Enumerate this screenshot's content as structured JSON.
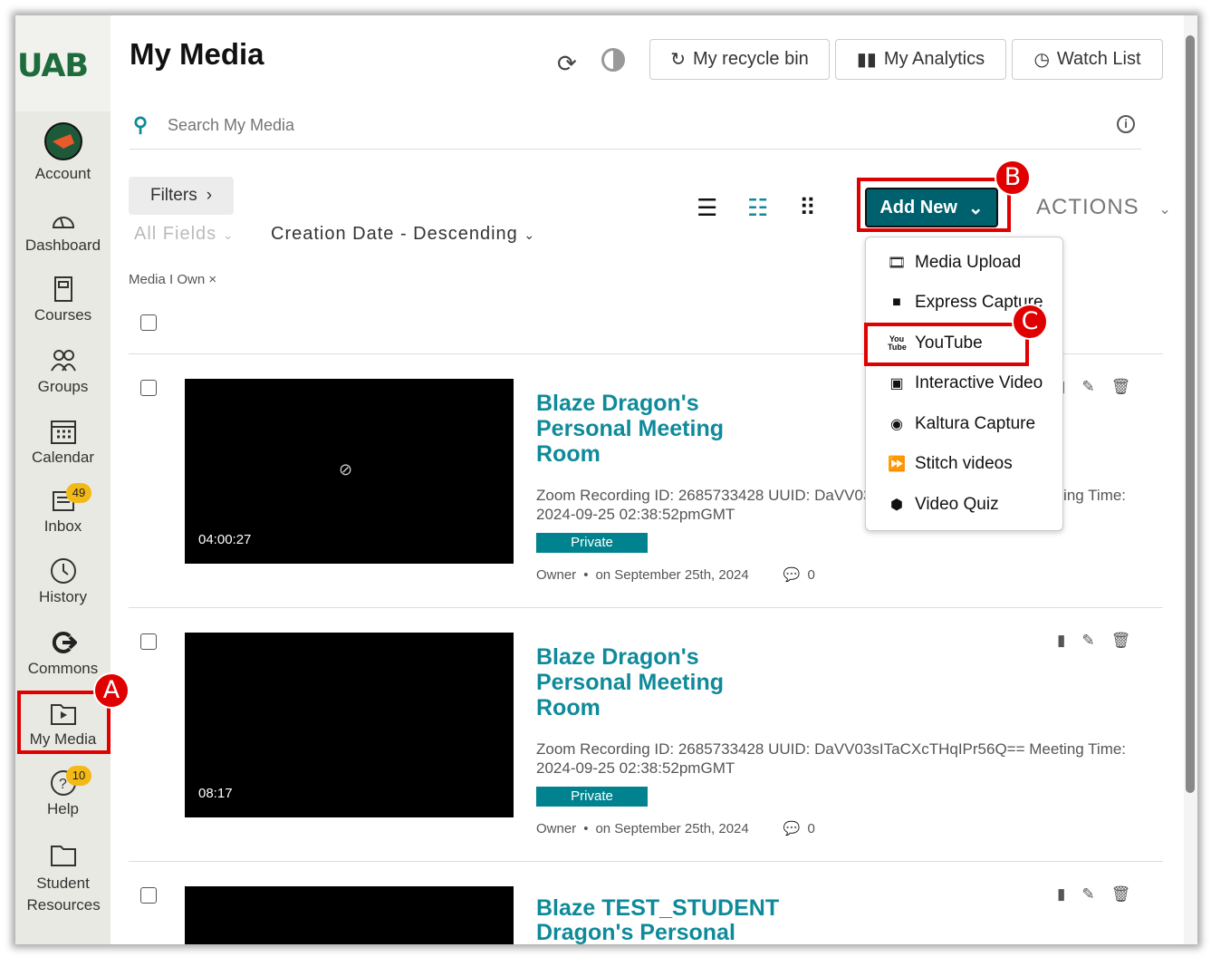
{
  "sidebar": {
    "logo": "UAB",
    "items": [
      {
        "label": "Account",
        "icon": "dragon-avatar-icon"
      },
      {
        "label": "Dashboard",
        "icon": "dashboard-icon"
      },
      {
        "label": "Courses",
        "icon": "book-icon"
      },
      {
        "label": "Groups",
        "icon": "groups-icon"
      },
      {
        "label": "Calendar",
        "icon": "calendar-icon"
      },
      {
        "label": "Inbox",
        "icon": "inbox-icon",
        "badge": "49"
      },
      {
        "label": "History",
        "icon": "clock-icon"
      },
      {
        "label": "Commons",
        "icon": "commons-icon"
      },
      {
        "label": "My Media",
        "icon": "media-folder-icon"
      },
      {
        "label": "Help",
        "icon": "help-icon",
        "badge": "10"
      },
      {
        "label": "Student Resources",
        "icon": "folder-icon"
      }
    ]
  },
  "header": {
    "title": "My Media",
    "recycle": "My recycle bin",
    "analytics": "My Analytics",
    "watchlist": "Watch List"
  },
  "search": {
    "placeholder": "Search My Media"
  },
  "toolbar": {
    "filters": "Filters",
    "fields": "All Fields",
    "sort": "Creation Date - Descending",
    "filter_tag": "Media I Own",
    "add_new": "Add New",
    "actions": "ACTIONS"
  },
  "menu": [
    "Media Upload",
    "Express Capture",
    "YouTube",
    "Interactive Video",
    "Kaltura Capture",
    "Stitch videos",
    "Video Quiz"
  ],
  "media": [
    {
      "title": "Blaze Dragon's Personal Meeting Room",
      "duration": "04:00:27",
      "desc": "Zoom Recording ID: 2685733428 UUID: DaVV03sITaCXcTHqIPr56Q== Meeting Time: 2024-09-25 02:38:52pmGMT",
      "status": "Private",
      "owner": "Owner",
      "date": "on September 25th, 2024",
      "comments": "0"
    },
    {
      "title": "Blaze Dragon's Personal Meeting Room",
      "duration": "08:17",
      "desc": "Zoom Recording ID: 2685733428 UUID: DaVV03sITaCXcTHqIPr56Q== Meeting Time: 2024-09-25 02:38:52pmGMT",
      "status": "Private",
      "owner": "Owner",
      "date": "on September 25th, 2024",
      "comments": "0"
    },
    {
      "title": "Blaze TEST_STUDENT Dragon's Personal"
    }
  ],
  "annotations": {
    "a": "A",
    "b": "B",
    "c": "C"
  },
  "colors": {
    "accent": "#0e8a9a",
    "button": "#00616e",
    "badge": "#f3b915",
    "annotation": "#e00000"
  }
}
